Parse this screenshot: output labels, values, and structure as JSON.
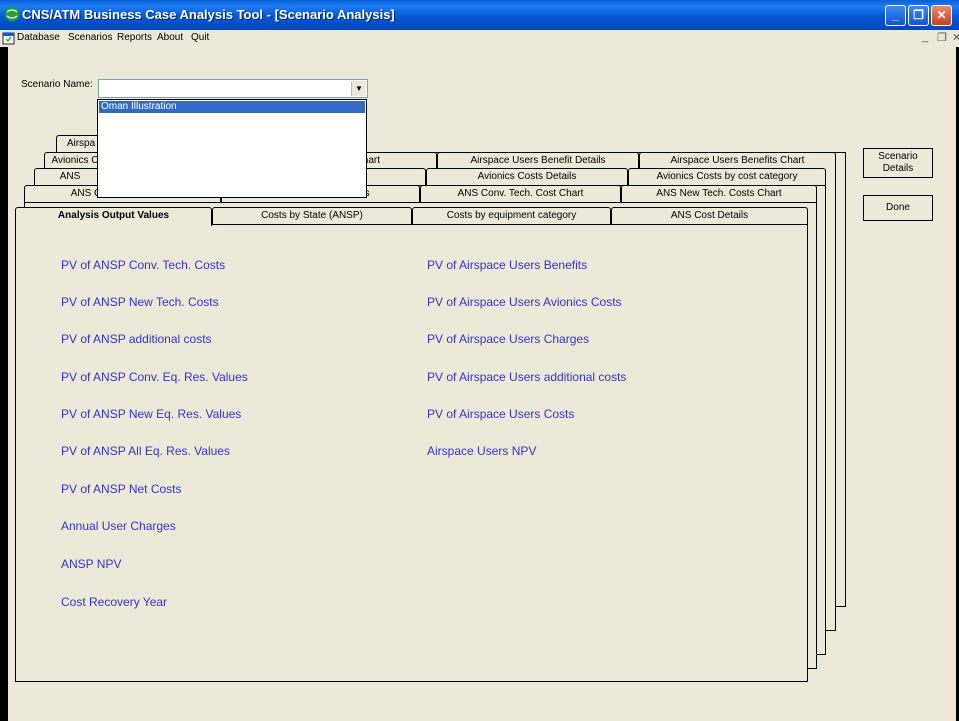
{
  "window": {
    "title": "CNS/ATM Business Case Analysis Tool - [Scenario Analysis]",
    "controls": [
      "_",
      "❐",
      "✕"
    ],
    "mdi_controls": [
      "_",
      "❐",
      "✕"
    ]
  },
  "menu": [
    "Database",
    "Scenarios",
    "Reports",
    "About",
    "Quit"
  ],
  "scenario": {
    "label": "Scenario Name:",
    "value": "",
    "options": [
      "Oman Illustration"
    ]
  },
  "tab_rows": [
    [
      "Airspa"
    ],
    [
      "Avionics C",
      "st Chart",
      "Airspace Users Benefit Details",
      "Airspace Users Benefits Chart"
    ],
    [
      "ANS",
      "rt",
      "Avionics Costs Details",
      "Avionics Costs by cost category"
    ],
    [
      "ANS Conv. Tech. Costs",
      "ANS New Tech. Costs",
      "ANS Conv. Tech. Cost Chart",
      "ANS New Tech. Costs Chart"
    ],
    [
      "Analysis Output Values",
      "Costs by State (ANSP)",
      "Costs by equipment category",
      "ANS Cost Details"
    ]
  ],
  "outputs_left": [
    "PV of ANSP Conv. Tech. Costs",
    "PV of ANSP New Tech. Costs",
    "PV of ANSP additional costs",
    "PV of ANSP Conv. Eq. Res. Values",
    "PV of ANSP New Eq. Res. Values",
    "PV of ANSP All Eq. Res. Values",
    "PV of ANSP Net Costs",
    "Annual User Charges",
    "ANSP NPV",
    "Cost Recovery Year"
  ],
  "outputs_right": [
    "PV of Airspace Users Benefits",
    "PV of Airspace Users Avionics Costs",
    "PV of Airspace Users Charges",
    "PV of Airspace Users additional costs",
    "PV of Airspace Users Costs",
    "Airspace Users NPV"
  ],
  "buttons": {
    "scenario_details": "Scenario Details",
    "done": "Done"
  },
  "colors": {
    "title_bar": "#0558d6",
    "output_text": "#3333cc",
    "selection": "#316ac5"
  }
}
